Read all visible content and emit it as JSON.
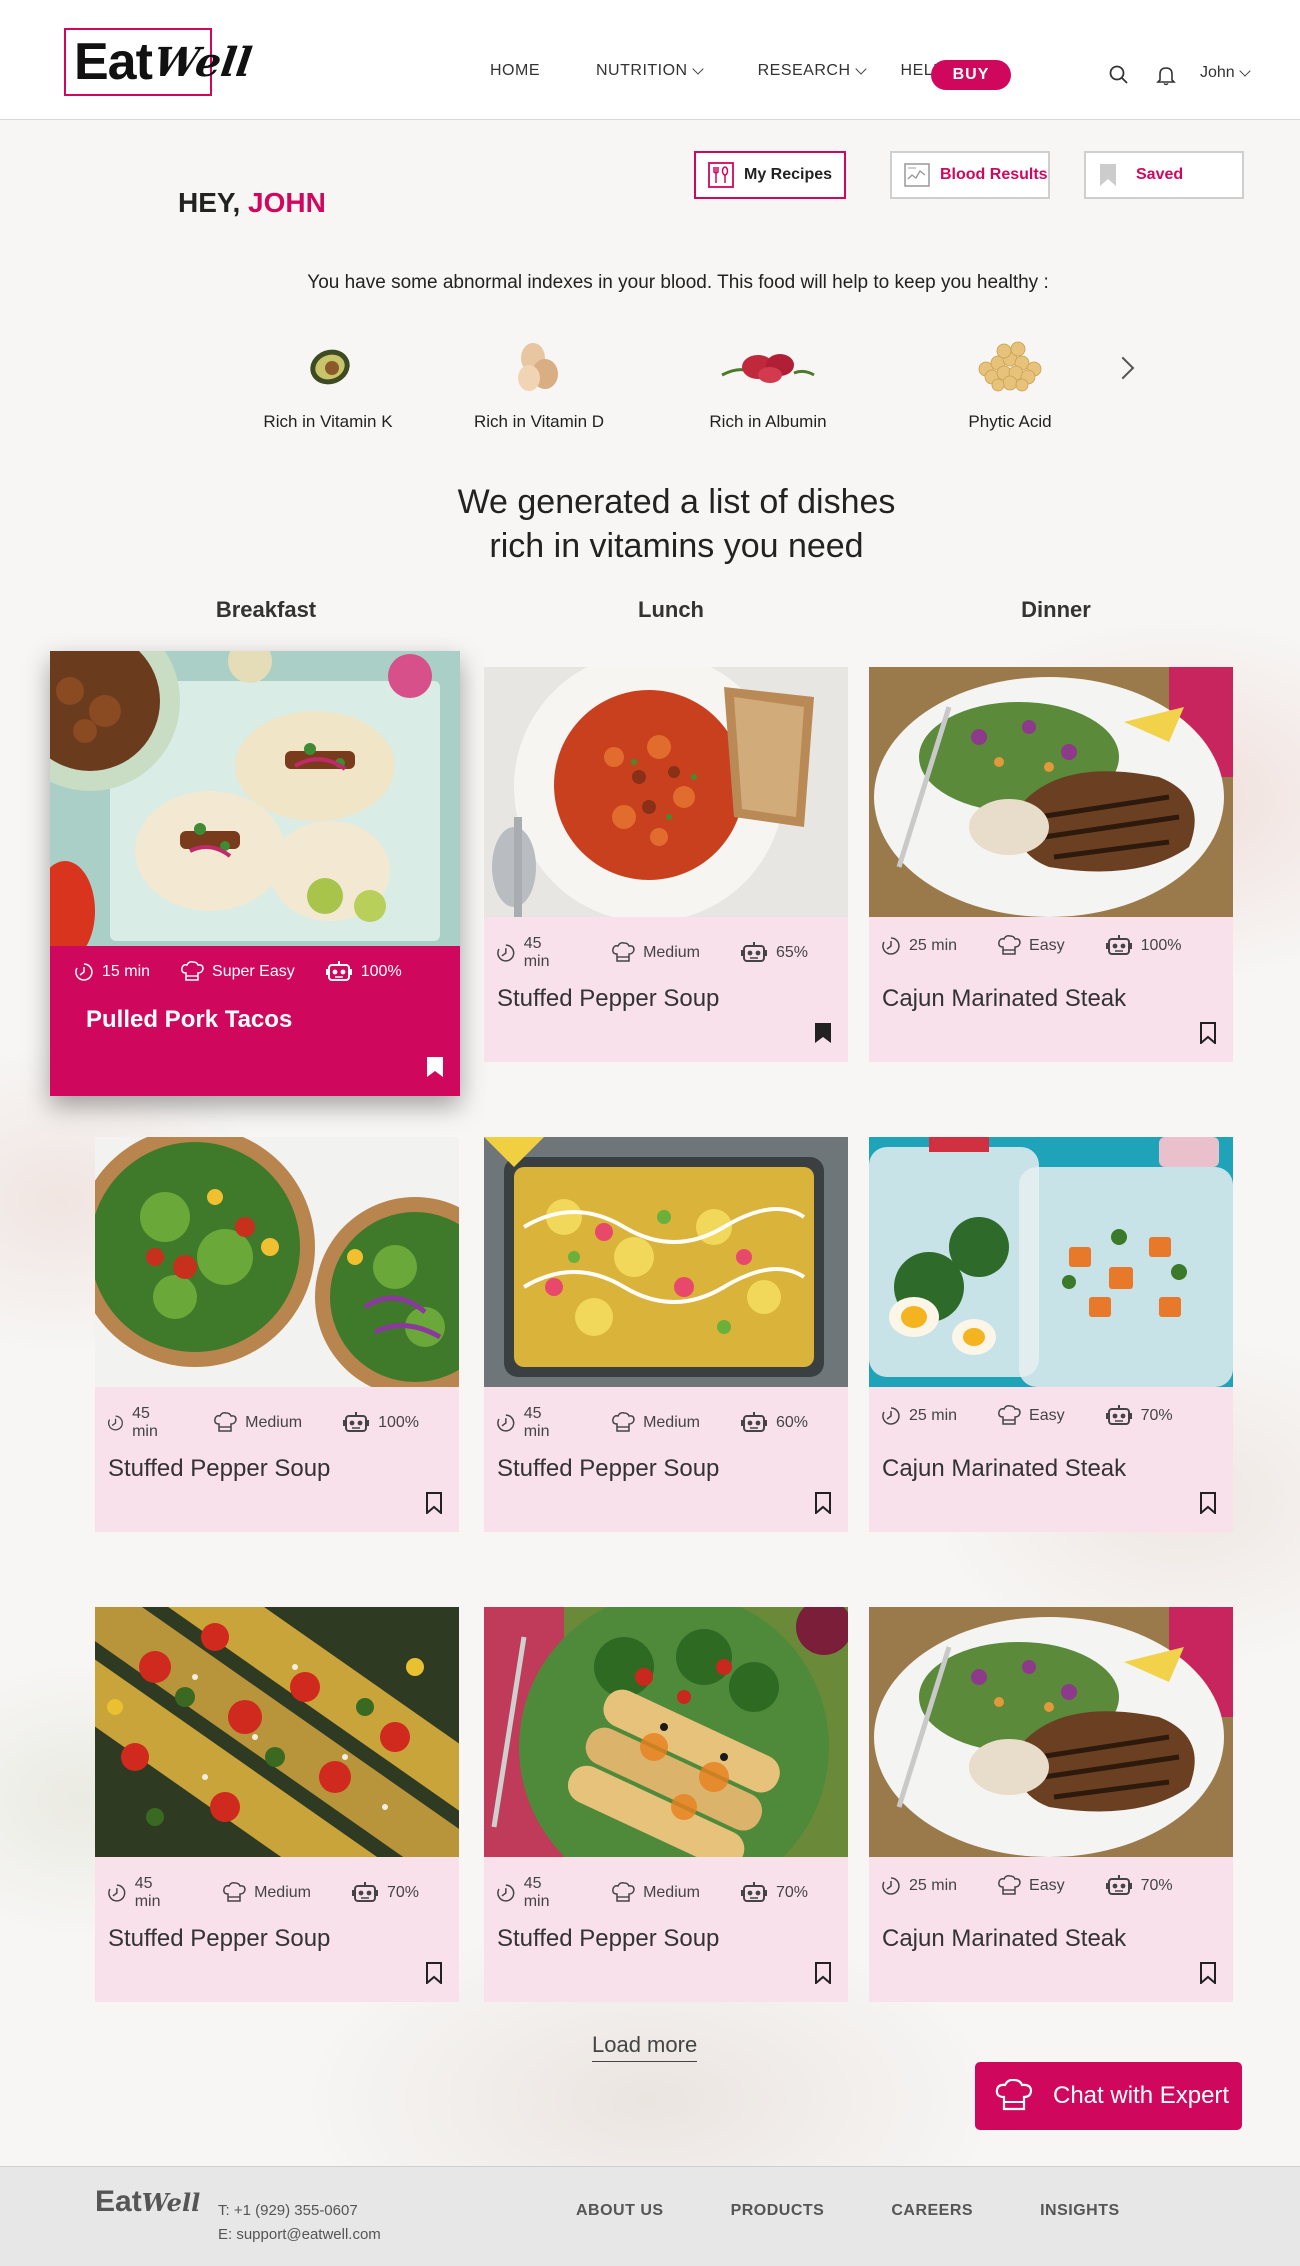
{
  "brand": {
    "logo_main": "Eat",
    "logo_script": "Well",
    "accent": "#d0085d"
  },
  "nav": {
    "items": [
      "HOME",
      "NUTRITION",
      "RESEARCH",
      "HELP"
    ],
    "buy": "BUY",
    "user": "John"
  },
  "hero": {
    "greeting": "HEY,",
    "name": "JOHN",
    "buttons": {
      "my_recipes": "My Recipes",
      "blood_results": "Blood Results",
      "saved": "Saved"
    },
    "subtitle": "You have some abnormal indexes in your blood. This food will help to keep you healthy :",
    "nutrients": [
      {
        "label": "Rich in Vitamin K",
        "icon": "avocado-icon"
      },
      {
        "label": "Rich in Vitamin D",
        "icon": "eggs-icon"
      },
      {
        "label": "Rich in Albumin",
        "icon": "meat-icon"
      },
      {
        "label": "Phytic Acid",
        "icon": "chickpeas-icon"
      }
    ],
    "headline_1": "We generated a list of dishes",
    "headline_2": "rich in vitamins you need"
  },
  "columns": [
    "Breakfast",
    "Lunch",
    "Dinner"
  ],
  "cards": [
    {
      "time": "15 min",
      "difficulty": "Super Easy",
      "match": "100%",
      "title": "Pulled Pork Tacos",
      "saved": true
    },
    {
      "time": "45 min",
      "difficulty": "Medium",
      "match": "65%",
      "title": "Stuffed Pepper Soup",
      "saved": true
    },
    {
      "time": "25 min",
      "difficulty": "Easy",
      "match": "100%",
      "title": "Cajun  Marinated Steak",
      "saved": false
    },
    {
      "time": "45 min",
      "difficulty": "Medium",
      "match": "100%",
      "title": "Stuffed Pepper Soup",
      "saved": false
    },
    {
      "time": "45 min",
      "difficulty": "Medium",
      "match": "60%",
      "title": "Stuffed Pepper Soup",
      "saved": false
    },
    {
      "time": "25 min",
      "difficulty": "Easy",
      "match": "70%",
      "title": "Cajun  Marinated Steak",
      "saved": false
    },
    {
      "time": "45 min",
      "difficulty": "Medium",
      "match": "70%",
      "title": "Stuffed Pepper Soup",
      "saved": false
    },
    {
      "time": "45 min",
      "difficulty": "Medium",
      "match": "70%",
      "title": "Stuffed Pepper Soup",
      "saved": false
    },
    {
      "time": "25 min",
      "difficulty": "Easy",
      "match": "70%",
      "title": "Cajun  Marinated Steak",
      "saved": false
    }
  ],
  "load_more": "Load more",
  "chat": "Chat with Expert",
  "footer": {
    "logo_main": "Eat",
    "logo_script": "Well",
    "phone": "T: +1 (929) 355-0607",
    "email": "E: support@eatwell.com",
    "links": [
      "ABOUT US",
      "PRODUCTS",
      "CAREERS",
      "INSIGHTS"
    ]
  }
}
